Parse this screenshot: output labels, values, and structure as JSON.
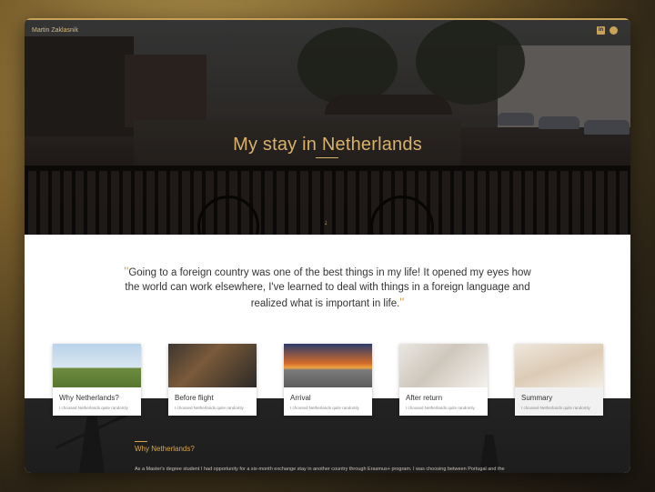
{
  "brand": "Martin Zaklasnik",
  "hero": {
    "title": "My stay in Netherlands"
  },
  "social": {
    "linkedin_label": "in"
  },
  "quote": {
    "text": "Going to a foreign country was one of the best things in my life! It opened my eyes how the world can work elsewhere, I've learned to deal with things in a foreign language and realized what is important in life.",
    "open_mark": "\"",
    "close_mark": "\""
  },
  "cards": [
    {
      "title": "Why Netherlands?",
      "subtitle": "I choosed Netherlands quite randomly"
    },
    {
      "title": "Before flight",
      "subtitle": "I choosed Netherlands quite randomly"
    },
    {
      "title": "Arrival",
      "subtitle": "I choosed Netherlands quite randomly"
    },
    {
      "title": "After return",
      "subtitle": "I choosed Netherlands quite randomly"
    },
    {
      "title": "Summary",
      "subtitle": "I choosed Netherlands quite randomly"
    }
  ],
  "section": {
    "title": "Why Netherlands?",
    "text": "As a Master's degree student I had opportunity for a six-month exchange stay in another country through Erasmus+ program. I was choosing between Portugal and the"
  },
  "icons": {
    "down_arrow": "↓"
  },
  "colors": {
    "accent": "#d9b16a",
    "dark": "#1d1d1d"
  }
}
